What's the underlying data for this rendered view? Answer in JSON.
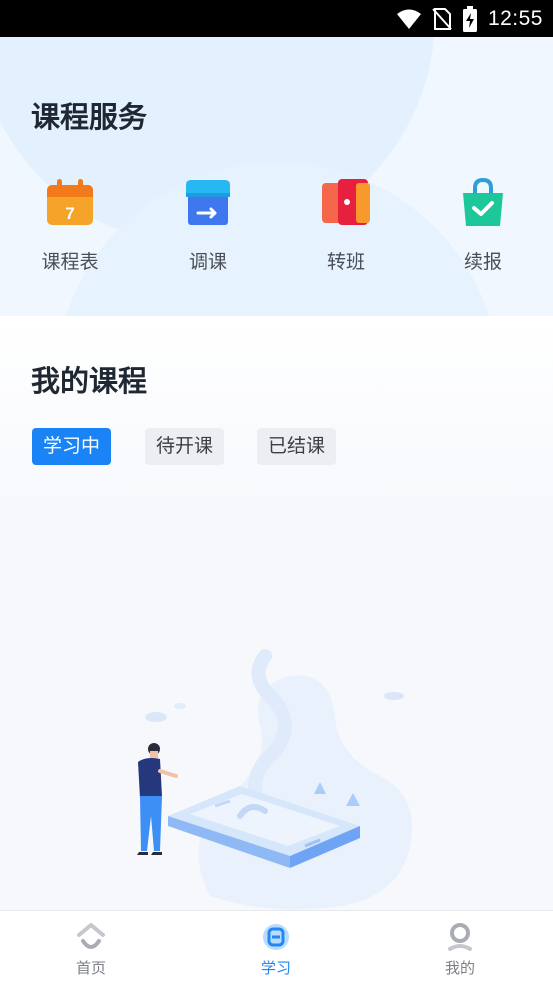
{
  "status_bar": {
    "time": "12:55"
  },
  "services": {
    "title": "课程服务",
    "items": [
      {
        "label": "课程表",
        "icon": "calendar-icon",
        "badge": "7"
      },
      {
        "label": "调课",
        "icon": "reschedule-icon"
      },
      {
        "label": "转班",
        "icon": "transfer-class-icon"
      },
      {
        "label": "续报",
        "icon": "renew-bag-icon"
      }
    ]
  },
  "courses": {
    "title": "我的课程",
    "tabs": [
      {
        "label": "学习中",
        "active": true
      },
      {
        "label": "待开课",
        "active": false
      },
      {
        "label": "已结课",
        "active": false
      }
    ]
  },
  "bottom_nav": {
    "items": [
      {
        "label": "首页",
        "icon": "home-icon",
        "active": false
      },
      {
        "label": "学习",
        "icon": "study-icon",
        "active": true
      },
      {
        "label": "我的",
        "icon": "profile-icon",
        "active": false
      }
    ]
  },
  "colors": {
    "accent": "#1a83f5",
    "calendar": "#fb8c1e",
    "reschedule": "#3d88f4",
    "transfer": "#f2374d",
    "renew": "#1cc89a"
  }
}
